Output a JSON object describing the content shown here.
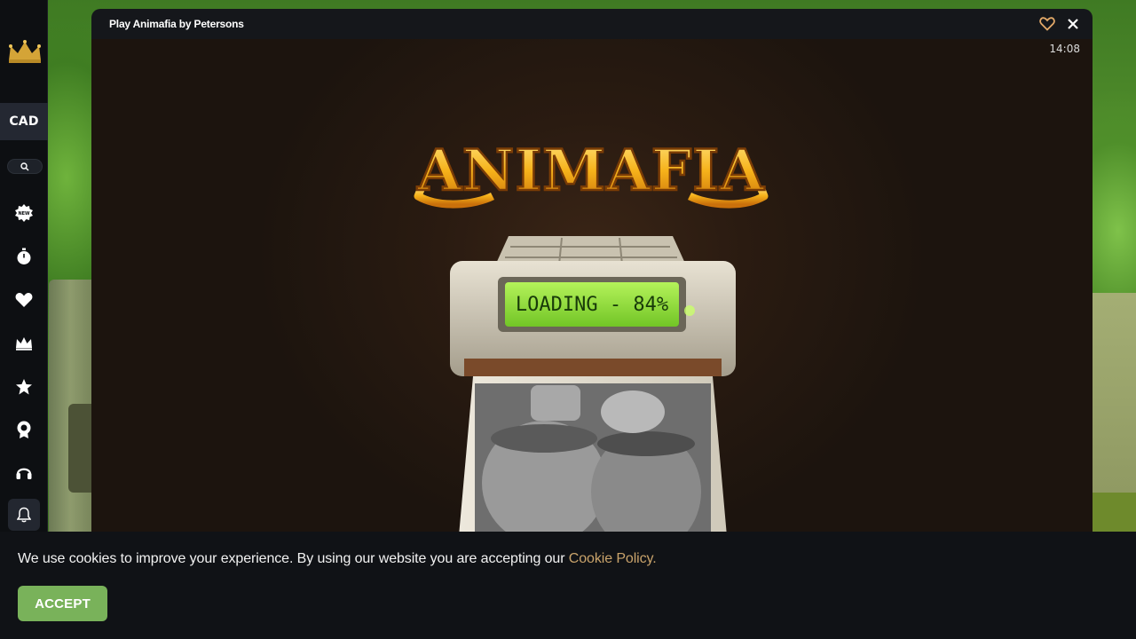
{
  "sidebar": {
    "currency": "CAD",
    "icons": [
      "crown-logo-icon",
      "search-icon",
      "new-badge-icon",
      "stopwatch-icon",
      "heart-icon",
      "crown-icon",
      "star-icon",
      "award-icon",
      "headset-icon",
      "bell-icon"
    ]
  },
  "modal": {
    "title": "Play Animafia by Petersons",
    "clock": "14:08"
  },
  "game": {
    "logo_text": "ANIMAFIA",
    "loading_text": "LOADING - 84%",
    "loading_progress": 0.84
  },
  "cookie": {
    "text": "We use cookies to improve your experience. By using our website you are accepting our ",
    "link": "Cookie Policy.",
    "accept_label": "ACCEPT"
  },
  "colors": {
    "accent_green": "#79b25a",
    "link_gold": "#c9a36b",
    "fav_heart": "#e3a969",
    "lcd_green": "#8ed63a"
  }
}
